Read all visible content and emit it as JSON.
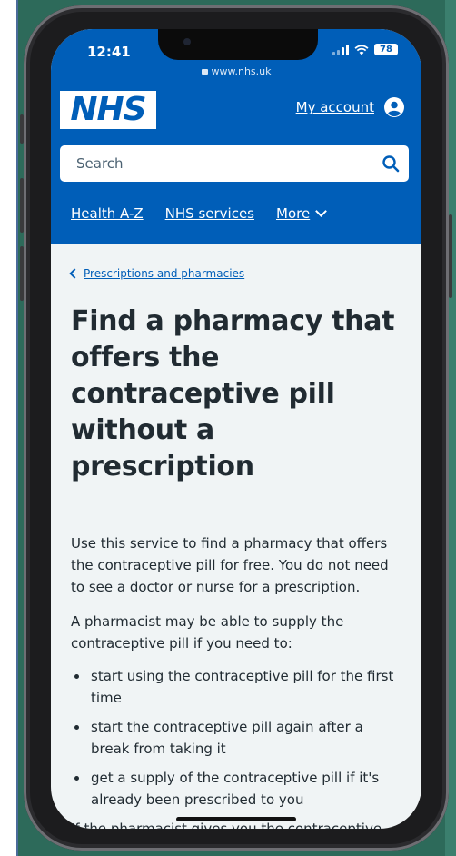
{
  "status_bar": {
    "time": "12:41",
    "battery": "78"
  },
  "browser": {
    "url": "www.nhs.uk"
  },
  "header": {
    "logo": "NHS",
    "account_label": "My account",
    "search_placeholder": "Search"
  },
  "nav": {
    "items": [
      "Health A-Z",
      "NHS services"
    ],
    "more_label": "More"
  },
  "breadcrumb": {
    "label": "Prescriptions and pharmacies"
  },
  "page": {
    "title": "Find a pharmacy that offers the contraceptive pill without a prescription",
    "intro": "Use this service to find a pharmacy that offers the contraceptive pill for free. You do not need to see a doctor or nurse for a prescription.",
    "lead": "A pharmacist may be able to supply the contraceptive pill if you need to:",
    "bullets": [
      "start using the contraceptive pill for the first time",
      "start the contraceptive pill again after a break from taking it",
      "get a supply of the contraceptive pill if it's already been prescribed to you"
    ],
    "partial": "If the pharmacist gives you the contraceptive"
  },
  "colors": {
    "nhs_blue": "#005eb8",
    "text": "#212b32",
    "page_bg": "#f0f4f5",
    "backdrop_green": "#2d6a5a"
  }
}
